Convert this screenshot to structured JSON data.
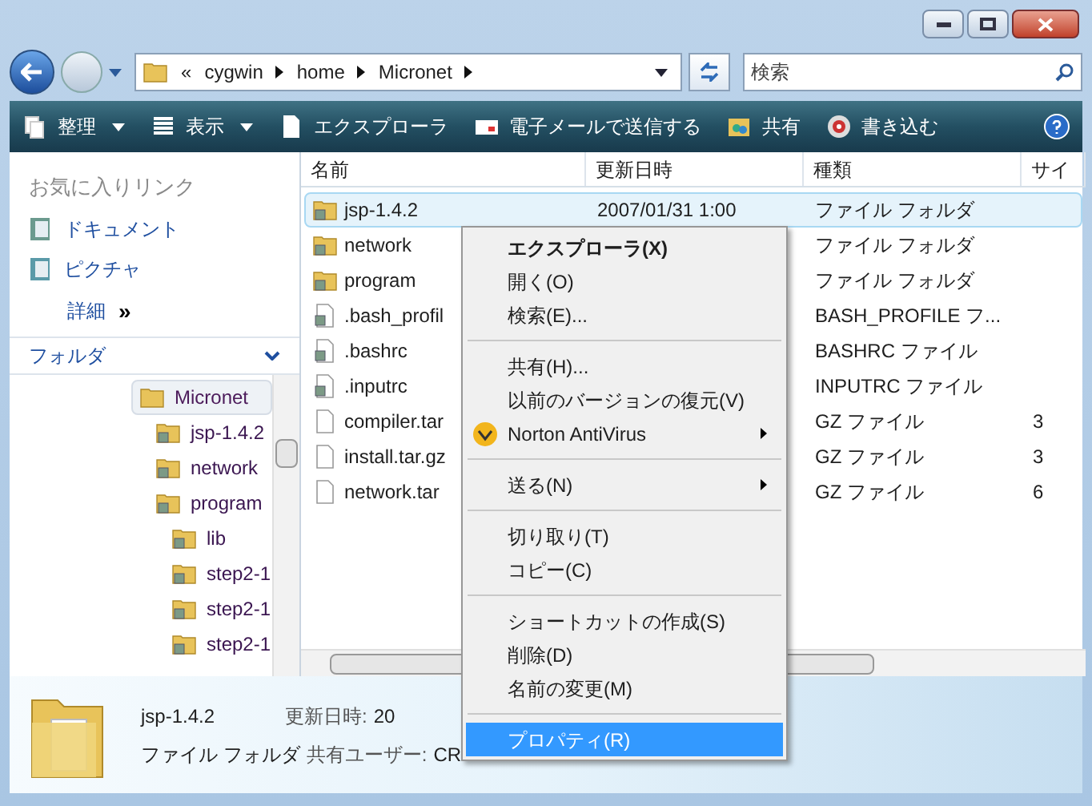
{
  "address": {
    "overflow": "«",
    "crumbs": [
      "cygwin",
      "home",
      "Micronet"
    ]
  },
  "search": {
    "placeholder": "検索"
  },
  "toolbar": [
    {
      "label": "整理",
      "kind": "organize",
      "dropdown": true
    },
    {
      "label": "表示",
      "kind": "views",
      "dropdown": true
    },
    {
      "label": "エクスプローラ",
      "kind": "explore",
      "dropdown": false
    },
    {
      "label": "電子メールで送信する",
      "kind": "email",
      "dropdown": false
    },
    {
      "label": "共有",
      "kind": "share",
      "dropdown": false
    },
    {
      "label": "書き込む",
      "kind": "burn",
      "dropdown": false
    }
  ],
  "favorites": {
    "title": "お気に入りリンク",
    "items": [
      {
        "label": "ドキュメント",
        "kind": "doc"
      },
      {
        "label": "ピクチャ",
        "kind": "pic"
      }
    ],
    "more": {
      "label": "詳細",
      "glyph": "»"
    }
  },
  "folders": {
    "title": "フォルダ",
    "tree": [
      {
        "label": "Micronet",
        "selected": true,
        "children": [
          {
            "label": "jsp-1.4.2",
            "selected": false
          },
          {
            "label": "network",
            "selected": false
          },
          {
            "label": "program",
            "selected": false,
            "children": [
              {
                "label": "lib",
                "selected": false
              },
              {
                "label": "step2-1",
                "selected": false
              },
              {
                "label": "step2-1",
                "selected": false
              },
              {
                "label": "step2-1",
                "selected": false
              }
            ]
          }
        ]
      }
    ]
  },
  "table": {
    "columns": [
      "名前",
      "更新日時",
      "種類",
      "サイ"
    ],
    "rows": [
      {
        "name": "jsp-1.4.2",
        "date": "2007/01/31 1:00",
        "type": "ファイル フォルダ",
        "size": "",
        "kind": "folder",
        "selected": true
      },
      {
        "name": "network",
        "date": "",
        "type": "ファイル フォルダ",
        "size": "",
        "kind": "folder",
        "selected": false
      },
      {
        "name": "program",
        "date": "",
        "type": "ファイル フォルダ",
        "size": "",
        "kind": "folder",
        "selected": false
      },
      {
        "name": ".bash_profil",
        "date": "",
        "type": "BASH_PROFILE フ...",
        "size": "",
        "kind": "text",
        "selected": false
      },
      {
        "name": ".bashrc",
        "date": "",
        "type": "BASHRC ファイル",
        "size": "",
        "kind": "text",
        "selected": false
      },
      {
        "name": ".inputrc",
        "date": "",
        "type": "INPUTRC ファイル",
        "size": "",
        "kind": "text",
        "selected": false
      },
      {
        "name": "compiler.tar",
        "date": "",
        "type": "GZ ファイル",
        "size": "3",
        "kind": "file",
        "selected": false
      },
      {
        "name": "install.tar.gz",
        "date": "",
        "type": "GZ ファイル",
        "size": "3",
        "kind": "file",
        "selected": false
      },
      {
        "name": "network.tar",
        "date": "",
        "type": "GZ ファイル",
        "size": "6",
        "kind": "file",
        "selected": false
      }
    ]
  },
  "context_menu": [
    {
      "kind": "item",
      "label": "エクスプローラ(X)",
      "bold": true,
      "submenu": false,
      "selected": false
    },
    {
      "kind": "item",
      "label": "開く(O)",
      "bold": false,
      "submenu": false,
      "selected": false
    },
    {
      "kind": "item",
      "label": "検索(E)...",
      "bold": false,
      "submenu": false,
      "selected": false
    },
    {
      "kind": "separator"
    },
    {
      "kind": "item",
      "label": "共有(H)...",
      "bold": false,
      "submenu": false,
      "selected": false
    },
    {
      "kind": "item",
      "label": "以前のバージョンの復元(V)",
      "bold": false,
      "submenu": false,
      "selected": false
    },
    {
      "kind": "norton",
      "label": "Norton AntiVirus",
      "bold": false,
      "submenu": true,
      "selected": false
    },
    {
      "kind": "separator"
    },
    {
      "kind": "item",
      "label": "送る(N)",
      "bold": false,
      "submenu": true,
      "selected": false
    },
    {
      "kind": "separator"
    },
    {
      "kind": "item",
      "label": "切り取り(T)",
      "bold": false,
      "submenu": false,
      "selected": false
    },
    {
      "kind": "item",
      "label": "コピー(C)",
      "bold": false,
      "submenu": false,
      "selected": false
    },
    {
      "kind": "separator"
    },
    {
      "kind": "item",
      "label": "ショートカットの作成(S)",
      "bold": false,
      "submenu": false,
      "selected": false
    },
    {
      "kind": "item",
      "label": "削除(D)",
      "bold": false,
      "submenu": false,
      "selected": false
    },
    {
      "kind": "item",
      "label": "名前の変更(M)",
      "bold": false,
      "submenu": false,
      "selected": false
    },
    {
      "kind": "separator"
    },
    {
      "kind": "item",
      "label": "プロパティ(R)",
      "bold": false,
      "submenu": false,
      "selected": true
    }
  ],
  "details": {
    "name": "jsp-1.4.2",
    "type": "ファイル フォルダ",
    "fields": [
      {
        "label": "更新日時:",
        "value": "20"
      },
      {
        "label": "共有ユーザー:",
        "value": "CR"
      }
    ]
  }
}
